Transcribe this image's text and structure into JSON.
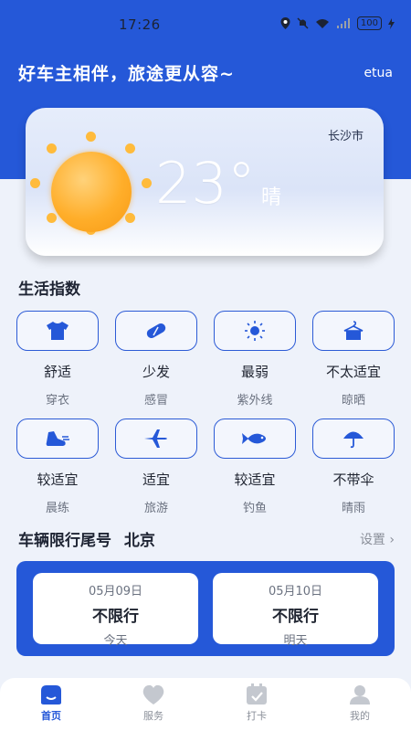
{
  "status_bar": {
    "time": "17:26",
    "battery": "100"
  },
  "header": {
    "greeting": "好车主相伴，旅途更从容~",
    "username": "etua"
  },
  "weather": {
    "city": "长沙市",
    "temperature": "23°",
    "condition": "晴",
    "icon": "sun-icon"
  },
  "life_index": {
    "title": "生活指数",
    "items": [
      {
        "value": "舒适",
        "label": "穿衣",
        "icon": "tshirt-icon"
      },
      {
        "value": "少发",
        "label": "感冒",
        "icon": "pill-icon"
      },
      {
        "value": "最弱",
        "label": "紫外线",
        "icon": "sun-rays-icon"
      },
      {
        "value": "不太适宜",
        "label": "晾晒",
        "icon": "hanger-icon"
      },
      {
        "value": "较适宜",
        "label": "晨练",
        "icon": "running-shoe-icon"
      },
      {
        "value": "适宜",
        "label": "旅游",
        "icon": "airplane-icon"
      },
      {
        "value": "较适宜",
        "label": "钓鱼",
        "icon": "fish-icon"
      },
      {
        "value": "不带伞",
        "label": "晴雨",
        "icon": "umbrella-icon"
      }
    ]
  },
  "restriction": {
    "title": "车辆限行尾号",
    "city": "北京",
    "settings_label": "设置 ›",
    "days": [
      {
        "date": "05月09日",
        "status": "不限行",
        "label": "今天"
      },
      {
        "date": "05月10日",
        "status": "不限行",
        "label": "明天"
      }
    ]
  },
  "tabbar": {
    "items": [
      {
        "label": "首页",
        "icon": "home-icon",
        "active": true
      },
      {
        "label": "服务",
        "icon": "heart-icon",
        "active": false
      },
      {
        "label": "打卡",
        "icon": "calendar-check-icon",
        "active": false
      },
      {
        "label": "我的",
        "icon": "user-icon",
        "active": false
      }
    ]
  },
  "colors": {
    "primary": "#2558d8",
    "background": "#eef2fa",
    "sun": "#ffae2a"
  }
}
